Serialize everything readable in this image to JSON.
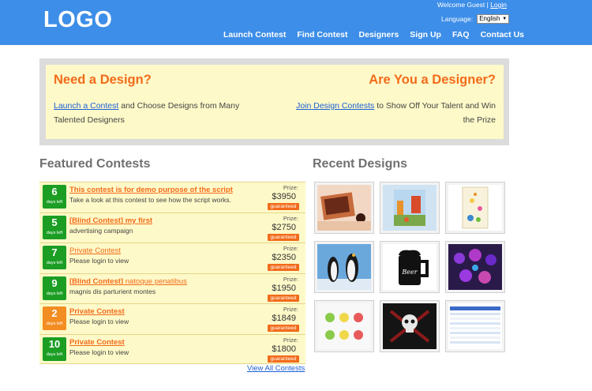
{
  "header": {
    "logo": "LOGO",
    "welcome": "Welcome Guest |",
    "login": "Login",
    "language_label": "Language:",
    "language_value": "English",
    "nav": [
      "Launch Contest",
      "Find Contest",
      "Designers",
      "Sign Up",
      "FAQ",
      "Contact Us"
    ]
  },
  "banner": {
    "left_title": "Need a Design?",
    "left_link": "Launch a Contest",
    "left_text": " and Choose Designs from Many Talented Designers",
    "right_title": "Are You a Designer?",
    "right_link": "Join Design Contests",
    "right_text": " to Show Off Your Talent and Win the Prize"
  },
  "featured": {
    "title": "Featured Contests",
    "days_label": "days left",
    "prize_label": "Prize:",
    "guaranteed_label": "guaranteed",
    "view_all": "View All Contests",
    "contests": [
      {
        "days": "6",
        "color": "green",
        "title": "This contest is for demo purpose of the script",
        "title_rest": "",
        "desc": "Take a look at this contest to see how the script works.",
        "prize": "$3950"
      },
      {
        "days": "5",
        "color": "green",
        "title": "[Blind Contest] my first",
        "title_rest": "",
        "desc": "advertising campaign",
        "prize": "$2750"
      },
      {
        "days": "7",
        "color": "green",
        "title": "Private Contest",
        "title_rest": "",
        "desc": "Please login to view",
        "prize": "$2350"
      },
      {
        "days": "9",
        "color": "green",
        "title": "[Blind Contest]",
        "title_rest": " natoque penatibus",
        "desc": "magnis dis parturient montes",
        "prize": "$1950"
      },
      {
        "days": "2",
        "color": "orange",
        "title": "Private Contest",
        "title_rest": "",
        "desc": "Please login to view",
        "prize": "$1849"
      },
      {
        "days": "10",
        "color": "green",
        "title": "Private Contest",
        "title_rest": "",
        "desc": "Please login to view",
        "prize": "$1800"
      }
    ]
  },
  "recent": {
    "title": "Recent Designs",
    "items": [
      "room-design",
      "street-scene",
      "flower-card",
      "penguins-photo",
      "beer-mug-logo",
      "purple-flowers",
      "smiley-faces",
      "skull-poster",
      "spreadsheet-screenshot"
    ]
  },
  "colors": {
    "header_bg": "#3d8ee8",
    "accent_orange": "#f26b1a",
    "banner_bg": "#fef9c8",
    "days_green": "#1b9e23",
    "days_orange": "#f38d22"
  }
}
